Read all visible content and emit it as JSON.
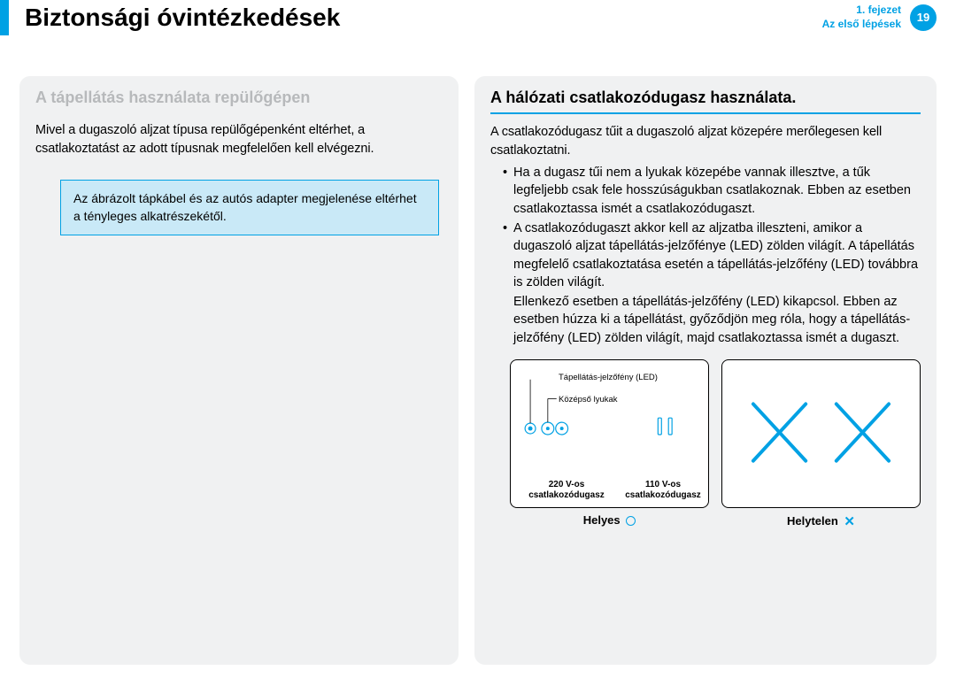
{
  "header": {
    "title": "Biztonsági óvintézkedések",
    "chapter_line1": "1. fejezet",
    "chapter_line2": "Az első lépések",
    "page_number": "19"
  },
  "left": {
    "subhead": "A tápellátás használata repülőgépen",
    "body": "Mivel a dugaszoló aljzat típusa repülőgépenként eltérhet, a csatlakoztatást az adott típusnak megfelelően kell elvégezni.",
    "note": "Az ábrázolt tápkábel és az autós adapter megjelenése eltérhet a tényleges alkatrészekétől."
  },
  "right": {
    "subhead": "A hálózati csatlakozódugasz használata.",
    "body": "A csatlakozódugasz tűit a dugaszoló aljzat közepére merőlegesen kell csatlakoztatni.",
    "bullet1": "Ha a dugasz tűi nem a lyukak közepébe vannak illesztve, a tűk legfeljebb csak fele hosszúságukban csatlakoznak. Ebben az esetben csatlakoztassa ismét a csatlakozódugaszt.",
    "bullet2": "A csatlakozódugaszt akkor kell az aljzatba illeszteni, amikor a dugaszoló aljzat tápellátás-jelzőfénye (LED) zölden világít. A tápellátás megfelelő csatlakoztatása esetén a tápellátás-jelzőfény (LED) továbbra is zölden világít.",
    "sub_after_b2": "Ellenkező esetben a tápellátás-jelzőfény (LED) kikapcsol. Ebben az esetben húzza ki a tápellátást, győződjön meg róla, hogy a tápellátás-jelzőfény (LED) zölden világít, majd csatlakoztassa ismét a dugaszt.",
    "diagram1": {
      "label_led": "Tápellátás-jelzőfény (LED)",
      "label_holes": "Középső lyukak",
      "plug220": "220 V-os csatlakozódugasz",
      "plug110": "110 V-os csatlakozódugasz"
    },
    "caption_correct": "Helyes",
    "caption_incorrect": "Helytelen"
  }
}
